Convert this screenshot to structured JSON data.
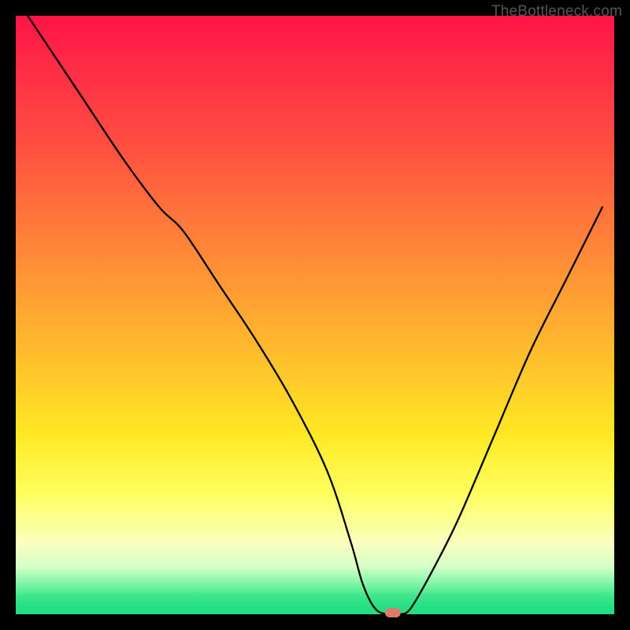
{
  "attribution": "TheBottleneck.com",
  "colors": {
    "page_bg": "#000000",
    "curve": "#000000",
    "marker": "#e07b6b",
    "gradient_top": "#ff1446",
    "gradient_mid": "#ffc82a",
    "gradient_bottom": "#22df84"
  },
  "chart_data": {
    "type": "line",
    "title": "",
    "xlabel": "",
    "ylabel": "",
    "xlim": [
      0,
      100
    ],
    "ylim": [
      0,
      100
    ],
    "grid": false,
    "legend": false,
    "x": [
      2,
      10,
      18,
      24,
      28,
      34,
      40,
      46,
      52,
      56,
      58,
      60,
      62,
      64,
      66,
      70,
      74,
      80,
      86,
      92,
      98
    ],
    "values": [
      100,
      88,
      76,
      68,
      64,
      55,
      46,
      36,
      24,
      12,
      5,
      1,
      0,
      0,
      1,
      8,
      16,
      30,
      44,
      56,
      68
    ],
    "marker": {
      "x": 63,
      "y": 0
    },
    "notes": "Bottleneck-style V curve over a red→yellow→green vertical gradient. Minimum near x≈63. Values estimated from pixels; no axis ticks present in source."
  }
}
